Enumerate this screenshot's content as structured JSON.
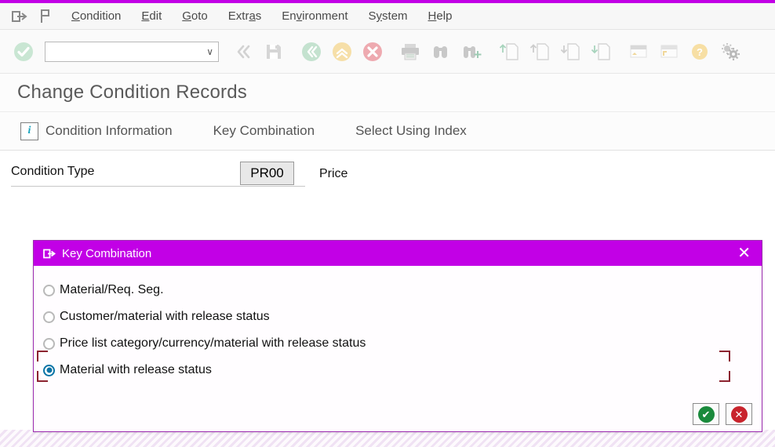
{
  "window": {
    "accent_color": "#c200e6"
  },
  "menubar": {
    "icons": [
      {
        "name": "sap-session-icon",
        "glyph": "session"
      },
      {
        "name": "sap-p-icon",
        "glyph": "p"
      }
    ],
    "items": [
      {
        "label": "Condition",
        "acc": "C"
      },
      {
        "label": "Edit",
        "acc": "E"
      },
      {
        "label": "Goto",
        "acc": "G"
      },
      {
        "label": "Extras",
        "acc": "a"
      },
      {
        "label": "Environment",
        "acc": "v"
      },
      {
        "label": "System",
        "acc": "y"
      },
      {
        "label": "Help",
        "acc": "H"
      }
    ]
  },
  "toolbar": {
    "enter_label": "Enter",
    "command_field": {
      "value": "",
      "placeholder": ""
    },
    "dropdown_glyph": "∨",
    "buttons": [
      {
        "name": "back-button",
        "label": "Back"
      },
      {
        "name": "save-button",
        "label": "Save"
      },
      {
        "name": "exit-button",
        "label": "Exit"
      },
      {
        "name": "cancel-button",
        "label": "Cancel"
      },
      {
        "name": "stop-button",
        "label": "Stop Transaction"
      },
      {
        "name": "print-button",
        "label": "Print"
      },
      {
        "name": "find-button",
        "label": "Find"
      },
      {
        "name": "find-next-button",
        "label": "Find Next"
      },
      {
        "name": "first-page-button",
        "label": "First Page"
      },
      {
        "name": "previous-page-button",
        "label": "Previous Page"
      },
      {
        "name": "next-page-button",
        "label": "Next Page"
      },
      {
        "name": "last-page-button",
        "label": "Last Page"
      },
      {
        "name": "create-session-button",
        "label": "Create New Session"
      },
      {
        "name": "create-shortcut-button",
        "label": "Create Shortcut"
      },
      {
        "name": "help-button",
        "label": "Help"
      },
      {
        "name": "customize-button",
        "label": "Customize Local Layout"
      }
    ]
  },
  "page": {
    "title": "Change Condition Records"
  },
  "appbar": {
    "buttons": [
      {
        "label": "Condition Information",
        "icon": "info-icon",
        "icon_glyph": "i"
      },
      {
        "label": "Key Combination",
        "icon": null
      },
      {
        "label": "Select Using Index",
        "icon": null
      }
    ]
  },
  "form": {
    "condition_type_label": "Condition Type",
    "condition_type_value": "PR00",
    "condition_type_description": "Price"
  },
  "dialog": {
    "title": "Key Combination",
    "title_icon": "window-icon",
    "close_glyph": "✕",
    "options": [
      {
        "label": "Material/Req. Seg.",
        "selected": false
      },
      {
        "label": "Customer/material with release status",
        "selected": false
      },
      {
        "label": "Price list category/currency/material with release status",
        "selected": false
      },
      {
        "label": "Material with release status",
        "selected": true
      }
    ],
    "buttons": [
      {
        "name": "dialog-confirm-button",
        "label": "Continue",
        "glyph": "✔",
        "kind": "ok"
      },
      {
        "name": "dialog-cancel-button",
        "label": "Cancel",
        "glyph": "✕",
        "kind": "cancel"
      }
    ]
  }
}
